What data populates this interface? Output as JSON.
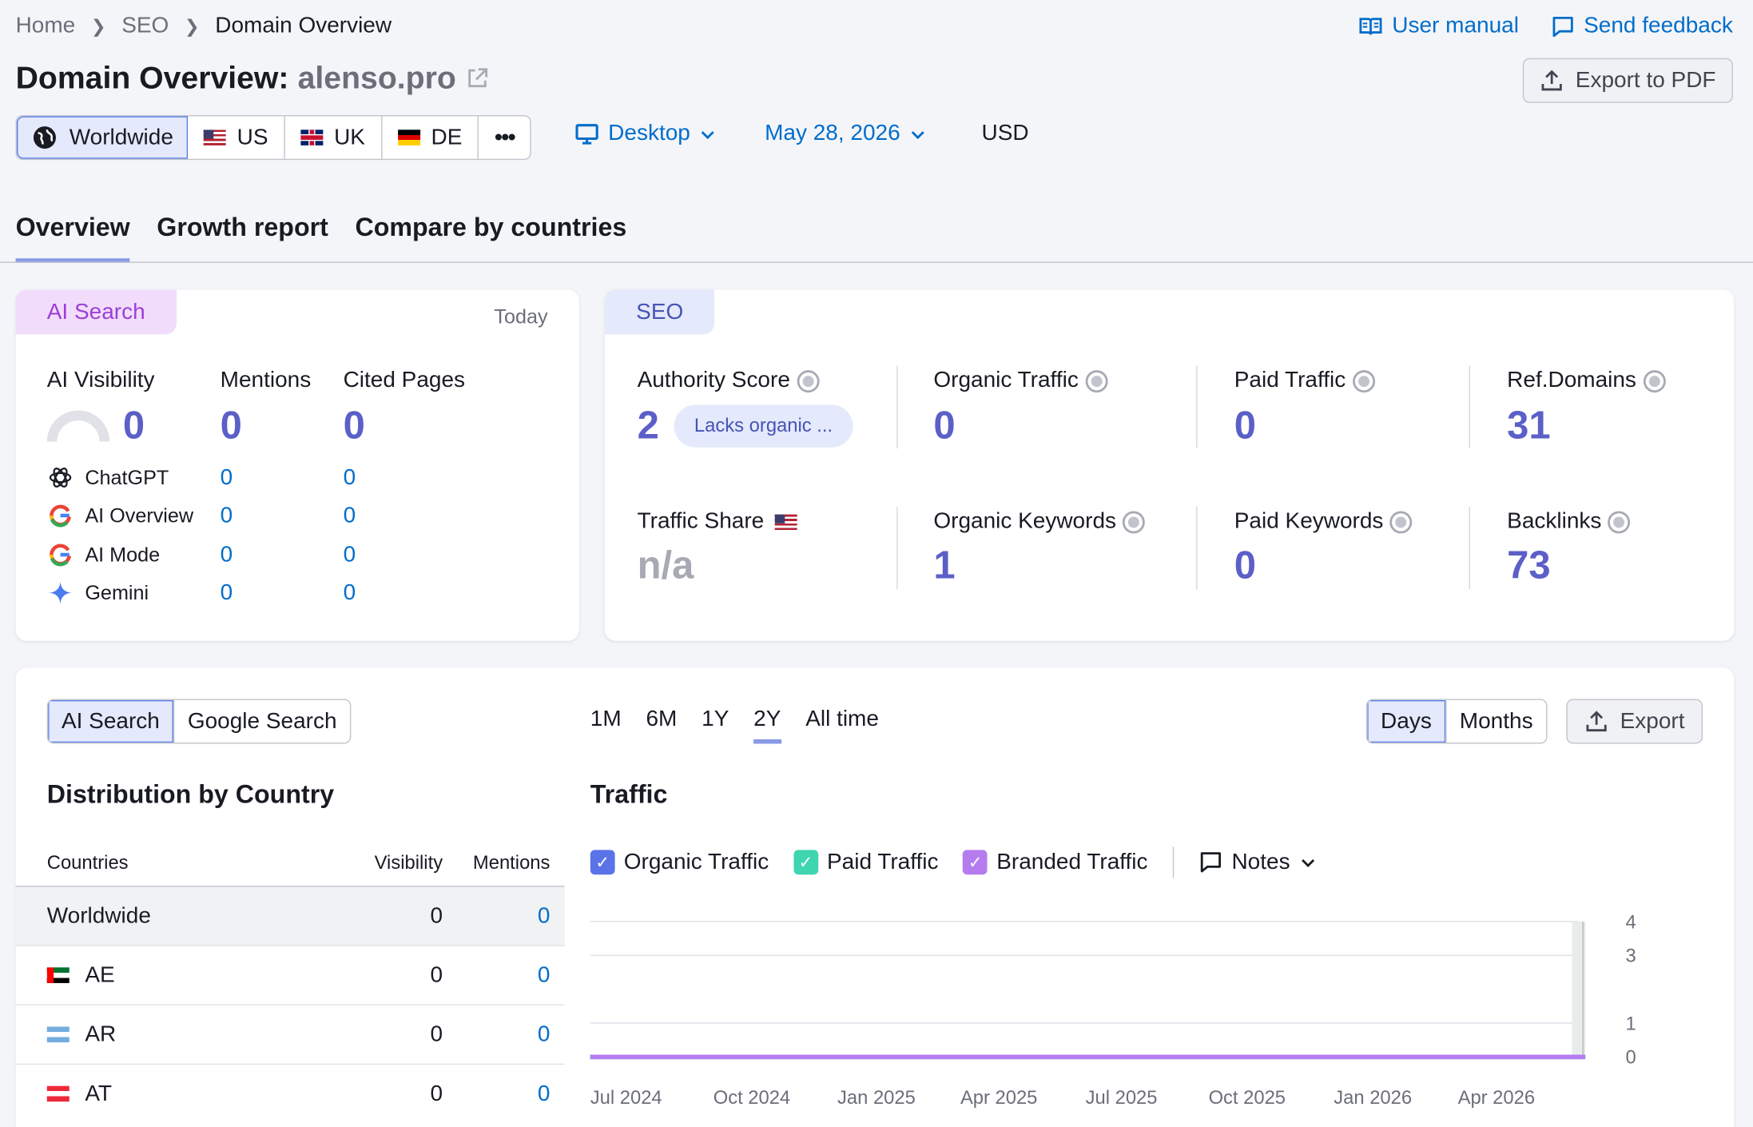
{
  "breadcrumb": [
    "Home",
    "SEO",
    "Domain Overview"
  ],
  "top_links": {
    "manual": "User manual",
    "feedback": "Send feedback"
  },
  "title": {
    "prefix": "Domain Overview:",
    "domain": "alenso.pro"
  },
  "export_pdf": "Export to PDF",
  "databases": {
    "worldwide": "Worldwide",
    "us": "US",
    "uk": "UK",
    "de": "DE",
    "more": "•••"
  },
  "device": "Desktop",
  "date": "May 28, 2026",
  "currency": "USD",
  "tabs": [
    "Overview",
    "Growth report",
    "Compare by countries"
  ],
  "ai_card": {
    "tag": "AI Search",
    "today": "Today",
    "headers": {
      "visibility": "AI Visibility",
      "mentions": "Mentions",
      "cited": "Cited Pages"
    },
    "totals": {
      "visibility": "0",
      "mentions": "0",
      "cited": "0"
    },
    "rows": [
      {
        "name": "ChatGPT",
        "mentions": "0",
        "cited": "0"
      },
      {
        "name": "AI Overview",
        "mentions": "0",
        "cited": "0"
      },
      {
        "name": "AI Mode",
        "mentions": "0",
        "cited": "0"
      },
      {
        "name": "Gemini",
        "mentions": "0",
        "cited": "0"
      }
    ]
  },
  "seo_card": {
    "tag": "SEO",
    "authority": {
      "label": "Authority Score",
      "value": "2",
      "badge": "Lacks organic ..."
    },
    "organic_traffic": {
      "label": "Organic Traffic",
      "value": "0"
    },
    "paid_traffic": {
      "label": "Paid Traffic",
      "value": "0"
    },
    "ref_domains": {
      "label": "Ref.Domains",
      "value": "31"
    },
    "traffic_share": {
      "label": "Traffic Share",
      "value": "n/a"
    },
    "organic_keywords": {
      "label": "Organic Keywords",
      "value": "1"
    },
    "paid_keywords": {
      "label": "Paid Keywords",
      "value": "0"
    },
    "backlinks": {
      "label": "Backlinks",
      "value": "73"
    }
  },
  "bottom": {
    "source_toggle": [
      "AI Search",
      "Google Search"
    ],
    "periods": [
      "1M",
      "6M",
      "1Y",
      "2Y",
      "All time"
    ],
    "granularity": [
      "Days",
      "Months"
    ],
    "export": "Export",
    "distribution_title": "Distribution by Country",
    "table_headers": {
      "countries": "Countries",
      "visibility": "Visibility",
      "mentions": "Mentions"
    },
    "table_rows": [
      {
        "country": "Worldwide",
        "visibility": "0",
        "mentions": "0"
      },
      {
        "country": "AE",
        "visibility": "0",
        "mentions": "0"
      },
      {
        "country": "AR",
        "visibility": "0",
        "mentions": "0"
      },
      {
        "country": "AT",
        "visibility": "0",
        "mentions": "0"
      }
    ],
    "traffic_title": "Traffic",
    "legend": {
      "organic": "Organic Traffic",
      "paid": "Paid Traffic",
      "branded": "Branded Traffic",
      "notes": "Notes"
    }
  },
  "colors": {
    "accent": "#006dca",
    "metric": "#5b5fc7",
    "organic": "#5b73e8",
    "paid": "#3fd5b0",
    "branded": "#b57cf0"
  },
  "chart_data": {
    "type": "line",
    "title": "Traffic",
    "x": [
      "Jul 2024",
      "Oct 2024",
      "Jan 2025",
      "Apr 2025",
      "Jul 2025",
      "Oct 2025",
      "Jan 2026",
      "Apr 2026"
    ],
    "y_ticks": [
      "4",
      "3",
      "1",
      "0"
    ],
    "ylim": [
      0,
      4
    ],
    "series": [
      {
        "name": "Organic Traffic",
        "values": [
          0,
          0,
          0,
          0,
          0,
          0,
          0,
          0
        ]
      },
      {
        "name": "Paid Traffic",
        "values": [
          0,
          0,
          0,
          0,
          0,
          0,
          0,
          0
        ]
      },
      {
        "name": "Branded Traffic",
        "values": [
          0,
          0,
          0,
          0,
          0,
          0,
          0,
          0
        ]
      }
    ],
    "grid": true
  }
}
